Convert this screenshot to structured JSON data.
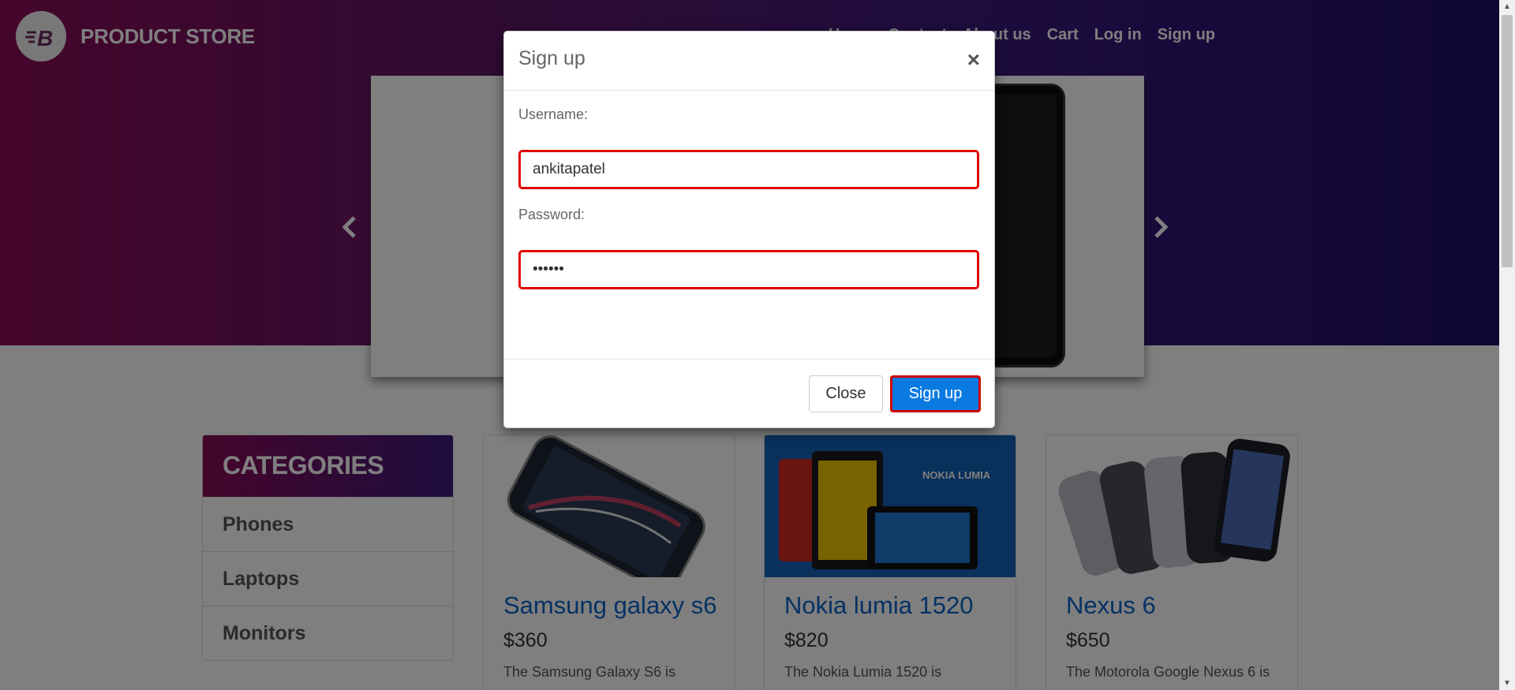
{
  "brand": {
    "name": "PRODUCT STORE",
    "logo_letter": "B"
  },
  "nav": {
    "items": [
      "Home",
      "Contact",
      "About us",
      "Cart",
      "Log in",
      "Sign up"
    ]
  },
  "carousel": {
    "prev_icon": "chevron-left-icon",
    "next_icon": "chevron-right-icon"
  },
  "sidebar": {
    "title": "CATEGORIES",
    "items": [
      "Phones",
      "Laptops",
      "Monitors"
    ]
  },
  "products": [
    {
      "title": "Samsung galaxy s6",
      "price": "$360",
      "desc": "The Samsung Galaxy S6 is"
    },
    {
      "title": "Nokia lumia 1520",
      "price": "$820",
      "desc": "The Nokia Lumia 1520 is",
      "img_text": "NOKIA LUMIA"
    },
    {
      "title": "Nexus 6",
      "price": "$650",
      "desc": "The Motorola Google Nexus 6 is"
    }
  ],
  "modal": {
    "title": "Sign up",
    "close_icon": "×",
    "username_label": "Username:",
    "username_value": "ankitapatel",
    "password_label": "Password:",
    "password_value": "••••••",
    "close_button": "Close",
    "signup_button": "Sign up"
  },
  "colors": {
    "accent_blue": "#0b7ae0",
    "error_red": "#e00000",
    "hero_start": "#8a0b57",
    "hero_end": "#200d6b",
    "link_blue": "#0a62c9"
  }
}
